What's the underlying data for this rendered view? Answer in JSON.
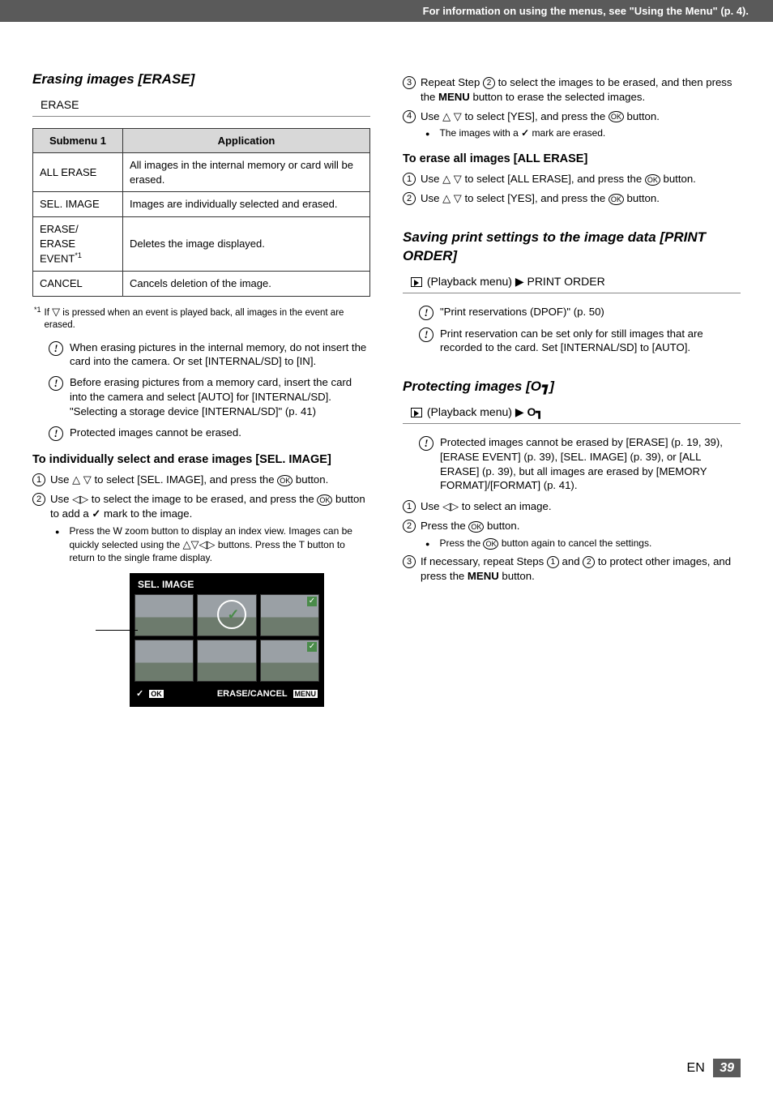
{
  "header": "For information on using the menus, see \"Using the Menu\" (p. 4).",
  "left": {
    "title": "Erasing images [ERASE]",
    "path": "ERASE",
    "table": {
      "h1": "Submenu 1",
      "h2": "Application",
      "rows": [
        {
          "c1": "ALL ERASE",
          "c2": "All images in the internal memory or card will be erased."
        },
        {
          "c1": "SEL. IMAGE",
          "c2": "Images are individually selected and erased."
        },
        {
          "c1": "ERASE/\nERASE EVENT*1",
          "c2": "Deletes the image displayed."
        },
        {
          "c1": "CANCEL",
          "c2": "Cancels deletion of the image."
        }
      ]
    },
    "footnote_ref": "*1",
    "footnote": "If ▽ is pressed when an event is played back, all images in the event are erased.",
    "notes": [
      "When erasing pictures in the internal memory, do not insert the card into the camera. Or set [INTERNAL/SD] to [IN].",
      "Before erasing pictures from a memory card, insert the card into the camera and select [AUTO] for [INTERNAL/SD]. \"Selecting a storage device [INTERNAL/SD]\" (p. 41)",
      "Protected images cannot be erased."
    ],
    "sub1_title": "To individually select and erase images [SEL. IMAGE]",
    "step1": "Use △ ▽ to select [SEL. IMAGE], and press the ⊛ button.",
    "step2": "Use ◁▷ to select the image to be erased, and press the ⊛ button to add a ✓ mark to the image.",
    "bullet1": "Press the W zoom button to display an index view. Images can be quickly selected using the △▽◁▷ buttons. Press the T button to return to the single frame display.",
    "mark_label": "✓ mark",
    "lcd": {
      "title": "SEL. IMAGE",
      "ok": "OK",
      "right": "ERASE/CANCEL",
      "menu": "MENU"
    }
  },
  "right": {
    "step3": "Repeat Step ② to select the images to be erased, and then press the MENU button to erase the selected images.",
    "step4": "Use △ ▽ to select [YES], and press the ⊛ button.",
    "bullet_r1": "The images with a ✓ mark are erased.",
    "sub2_title": "To erase all images [ALL ERASE]",
    "r_step1": "Use △ ▽ to select [ALL ERASE], and press the ⊛ button.",
    "r_step2": "Use △ ▽ to select [YES], and press the ⊛ button.",
    "sec2_title": "Saving print settings to the image data [PRINT ORDER]",
    "sec2_path": "(Playback menu) ▶ PRINT ORDER",
    "sec2_notes": [
      "\"Print reservations (DPOF)\" (p. 50)",
      "Print reservation can be set only for still images that are recorded to the card. Set [INTERNAL/SD] to [AUTO]."
    ],
    "sec3_title_a": "Protecting images [",
    "sec3_title_b": "]",
    "sec3_path": "(Playback menu) ▶ ",
    "sec3_note": "Protected images cannot be erased by [ERASE] (p. 19, 39), [ERASE EVENT] (p. 39), [SEL. IMAGE] (p. 39), or [ALL ERASE] (p. 39), but all images are erased by [MEMORY FORMAT]/[FORMAT] (p. 41).",
    "p_step1": "Use ◁▷ to select an image.",
    "p_step2": "Press the ⊛ button.",
    "p_bullet": "Press the ⊛ button again to cancel the settings.",
    "p_step3": "If necessary, repeat Steps ① and ② to protect other images, and press the MENU button."
  },
  "footer": {
    "lang": "EN",
    "page": "39"
  }
}
